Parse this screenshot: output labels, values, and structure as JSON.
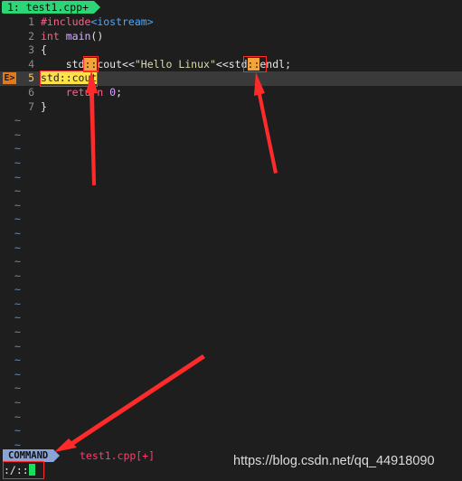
{
  "tab": {
    "label": "1: test1.cpp+"
  },
  "editor": {
    "lines": [
      {
        "num": "1",
        "segments": [
          {
            "t": "#include",
            "c": "pp"
          },
          {
            "t": "<iostream>",
            "c": "inc"
          }
        ]
      },
      {
        "num": "2",
        "segments": [
          {
            "t": "int",
            "c": "kw"
          },
          {
            "t": " ",
            "c": ""
          },
          {
            "t": "main",
            "c": "fn"
          },
          {
            "t": "()",
            "c": ""
          }
        ]
      },
      {
        "num": "3",
        "segments": [
          {
            "t": "{",
            "c": ""
          }
        ]
      },
      {
        "num": "4",
        "segments": [
          {
            "t": "    std",
            "c": ""
          },
          {
            "t": "::",
            "c": "hl"
          },
          {
            "t": "cout<<",
            "c": ""
          },
          {
            "t": "\"Hello Linux\"",
            "c": "str"
          },
          {
            "t": "<<std",
            "c": ""
          },
          {
            "t": "::",
            "c": "hl"
          },
          {
            "t": "endl;",
            "c": ""
          }
        ]
      },
      {
        "num": "5",
        "sign": "E>",
        "current": true,
        "segments": [
          {
            "t": "std::cout",
            "c": "hlcur"
          }
        ]
      },
      {
        "num": "6",
        "segments": [
          {
            "t": "    return ",
            "c": "kw"
          },
          {
            "t": "0",
            "c": "num"
          },
          {
            "t": ";",
            "c": ""
          }
        ]
      },
      {
        "num": "7",
        "segments": [
          {
            "t": "}",
            "c": ""
          }
        ]
      }
    ],
    "tilde_char": "~",
    "tilde_count": 24
  },
  "statusline": {
    "mode": "COMMAND",
    "file": "test1.cpp[+]"
  },
  "cmdline": {
    "text": ":/::"
  },
  "watermark": "https://blog.csdn.net/qq_44918090",
  "colors": {
    "tab_bg": "#2cd676",
    "mode_bg": "#8aa4d8",
    "match_hl": "#f2a33a",
    "cursor_hl": "#ffe24a",
    "annotation": "#ff2a2a"
  }
}
